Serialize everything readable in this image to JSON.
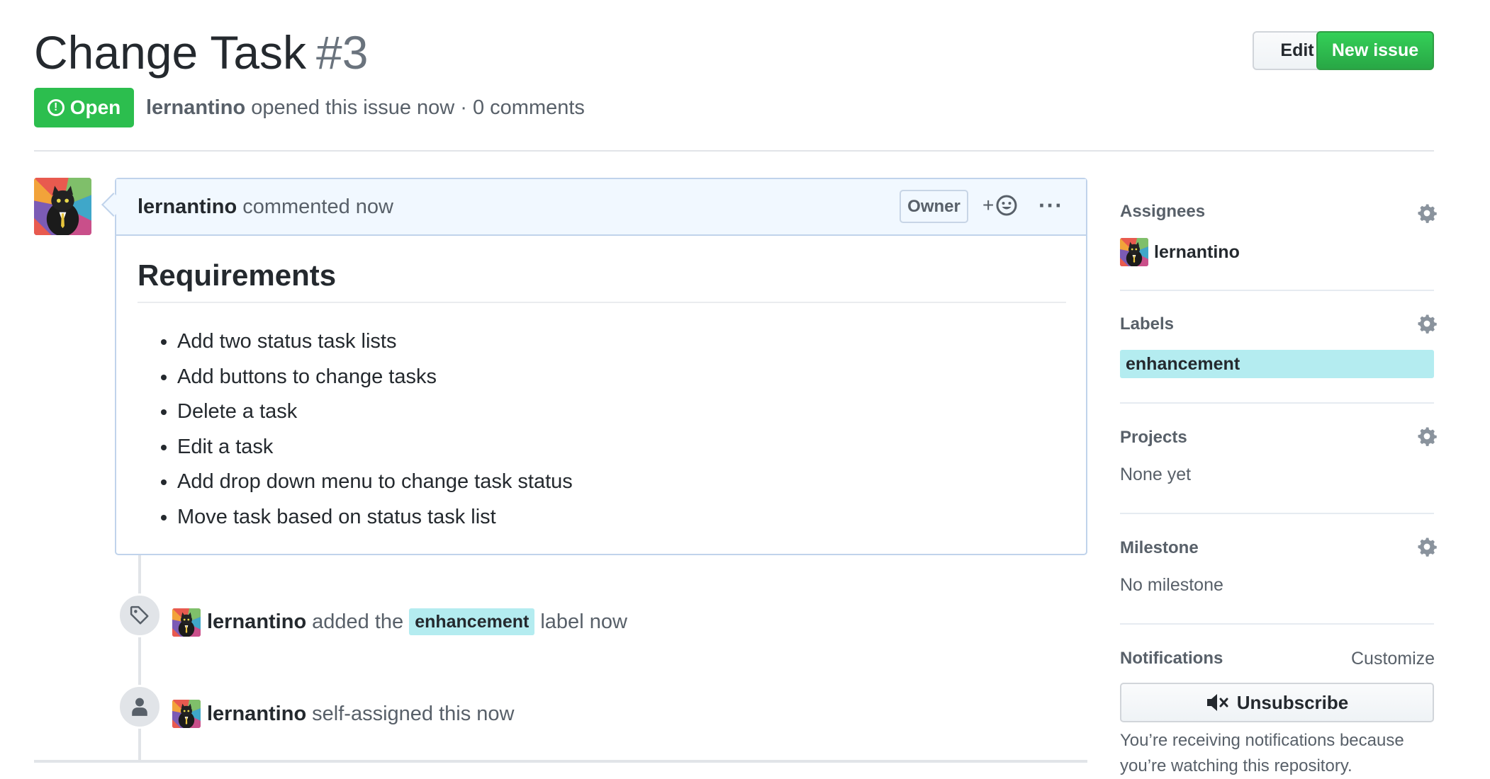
{
  "header": {
    "title": "Change Task",
    "number": "#3",
    "edit_label": "Edit",
    "new_issue_label": "New issue",
    "state_label": "Open",
    "author": "lernantino",
    "meta_text": "opened this issue now · 0 comments"
  },
  "comment": {
    "author": "lernantino",
    "action": "commented now",
    "owner_badge": "Owner",
    "react_plus": "+",
    "more": "···",
    "heading": "Requirements",
    "items": [
      "Add two status task lists",
      "Add buttons to change tasks",
      "Delete a task",
      "Edit a task",
      "Add drop down menu to change task status",
      "Move task based on status task list"
    ]
  },
  "timeline": {
    "labeled": {
      "author": "lernantino",
      "before": "added the",
      "label": "enhancement",
      "after": "label now"
    },
    "assigned": {
      "author": "lernantino",
      "text": "self-assigned this now"
    }
  },
  "sidebar": {
    "assignees_title": "Assignees",
    "assignee": "lernantino",
    "labels_title": "Labels",
    "label": "enhancement",
    "projects_title": "Projects",
    "projects_value": "None yet",
    "milestone_title": "Milestone",
    "milestone_value": "No milestone",
    "notifications_title": "Notifications",
    "customize": "Customize",
    "unsubscribe": "Unsubscribe",
    "notice": "You’re receiving notifications because you’re watching this repository."
  },
  "colors": {
    "open_green": "#2cbe4e",
    "label_bg": "#b4ecf0",
    "comment_head_bg": "#f1f8ff"
  }
}
